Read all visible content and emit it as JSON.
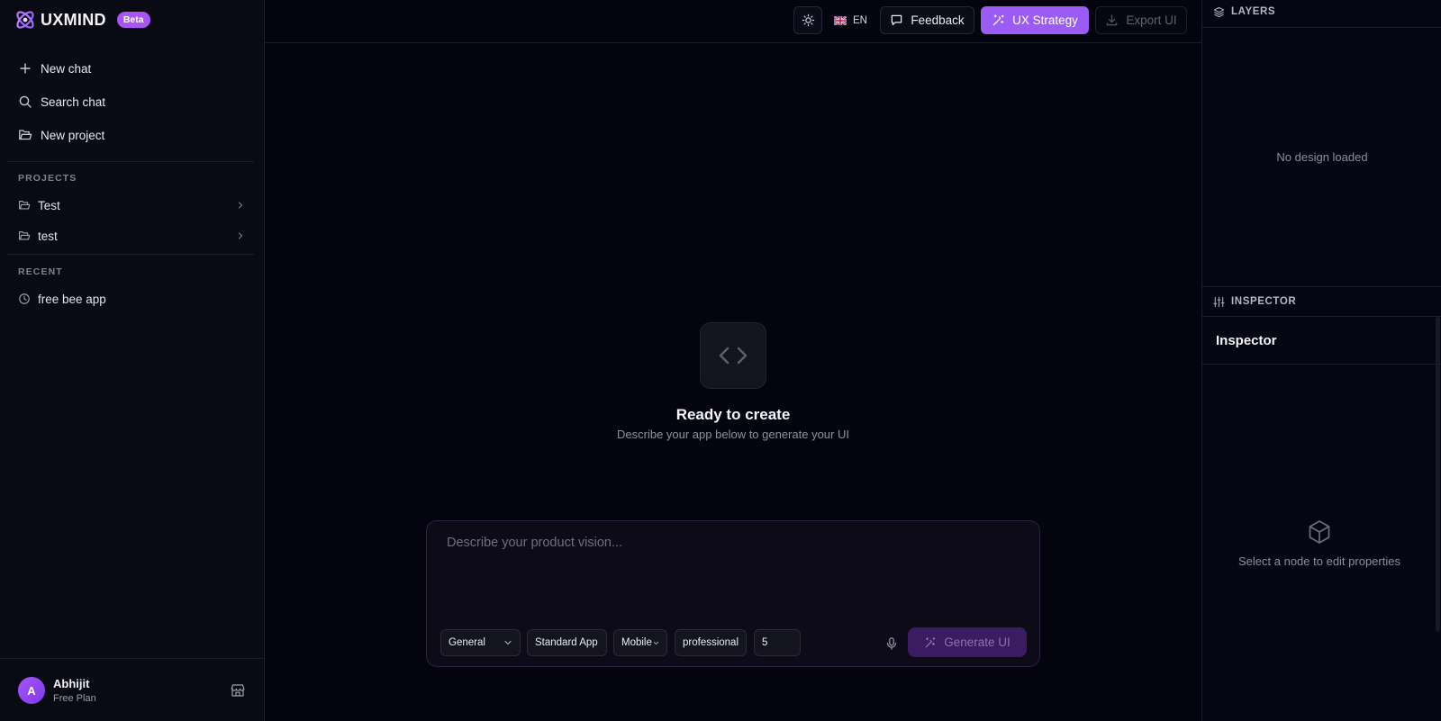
{
  "brand": {
    "name": "UXMIND",
    "badge": "Beta"
  },
  "sidebar": {
    "nav": [
      {
        "label": "New chat",
        "icon": "plus-icon"
      },
      {
        "label": "Search chat",
        "icon": "search-icon"
      },
      {
        "label": "New project",
        "icon": "folder-open-icon"
      }
    ],
    "projects_label": "PROJECTS",
    "projects": [
      {
        "label": "Test"
      },
      {
        "label": "test"
      }
    ],
    "recent_label": "RECENT",
    "recent": [
      {
        "label": "free bee app"
      }
    ],
    "user": {
      "initial": "A",
      "name": "Abhijit",
      "plan": "Free Plan"
    }
  },
  "topbar": {
    "language": "EN",
    "feedback_label": "Feedback",
    "ux_strategy_label": "UX Strategy",
    "export_label": "Export UI"
  },
  "center": {
    "title": "Ready to create",
    "subtitle": "Describe your app below to generate your UI"
  },
  "composer": {
    "placeholder": "Describe your product vision...",
    "category": "General",
    "app_type": "Standard App",
    "platform": "Mobile",
    "tone": "professional",
    "screens": "5",
    "generate_label": "Generate UI"
  },
  "right_panel": {
    "layers_label": "LAYERS",
    "no_design": "No design loaded",
    "inspector_header": "INSPECTOR",
    "inspector_title": "Inspector",
    "empty_hint": "Select a node to edit properties"
  },
  "colors": {
    "accent": "#9b5cf6",
    "background": "#04040f",
    "sidebar": "#0a0a15"
  }
}
